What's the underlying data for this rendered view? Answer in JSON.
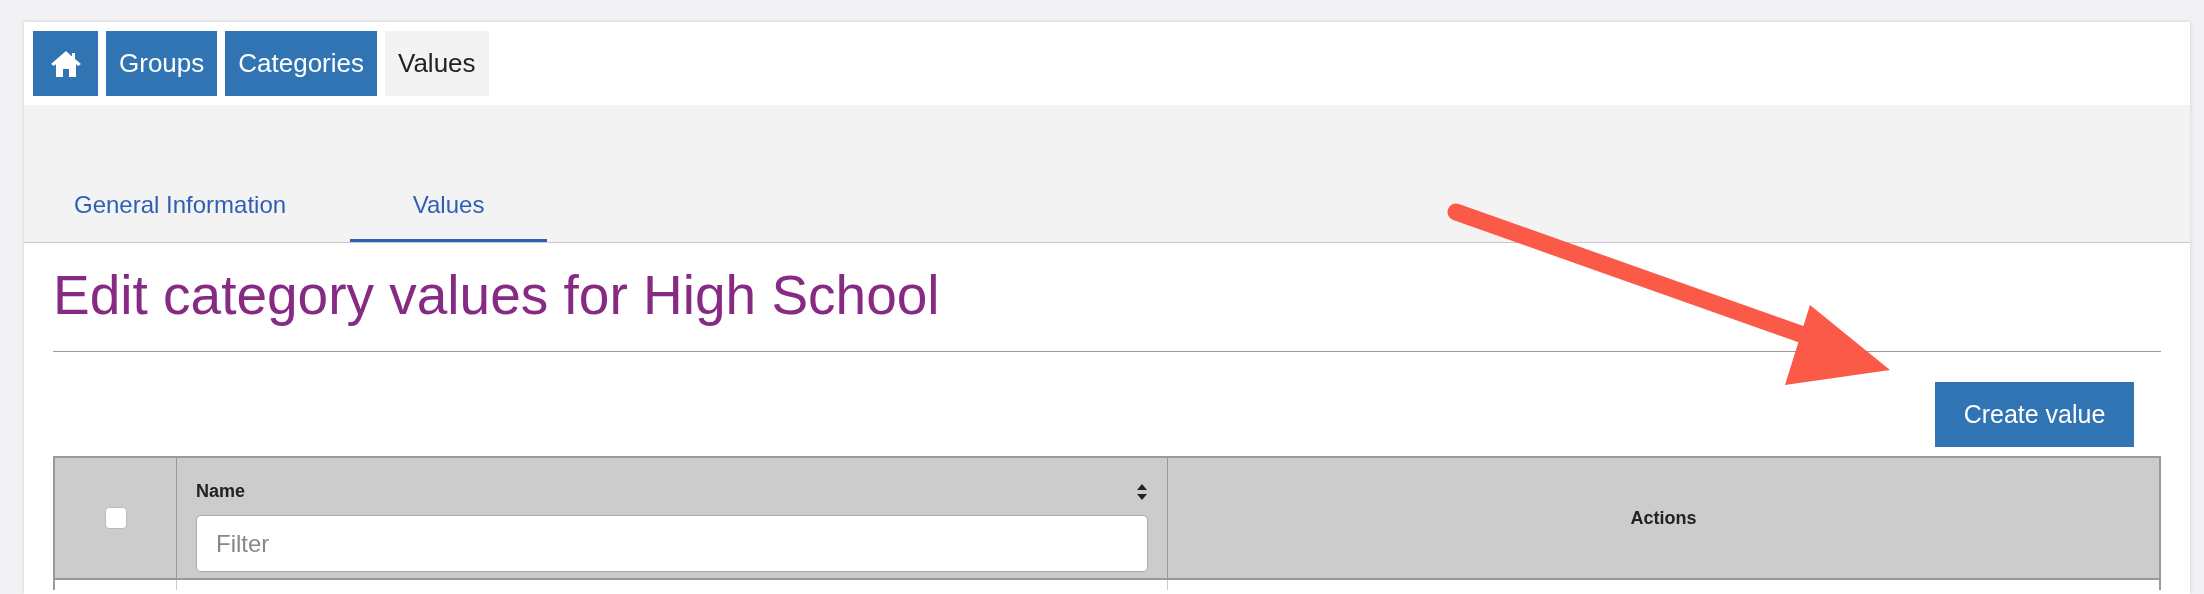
{
  "breadcrumbs": [
    {
      "kind": "home",
      "selected": false
    },
    {
      "kind": "link",
      "label": "Groups",
      "selected": false
    },
    {
      "kind": "link",
      "label": "Categories",
      "selected": false
    },
    {
      "kind": "link",
      "label": "Values",
      "selected": true
    }
  ],
  "tabs": [
    {
      "label": "General Information",
      "selected": false
    },
    {
      "label": "Values",
      "selected": true
    }
  ],
  "title": "Edit category values for High School",
  "create_button": "Create value",
  "table": {
    "select_all_checked": false,
    "columns": [
      {
        "label": "Name",
        "sortable": true,
        "filter_placeholder": "Filter"
      },
      {
        "label": "Actions",
        "sortable": false
      }
    ]
  }
}
